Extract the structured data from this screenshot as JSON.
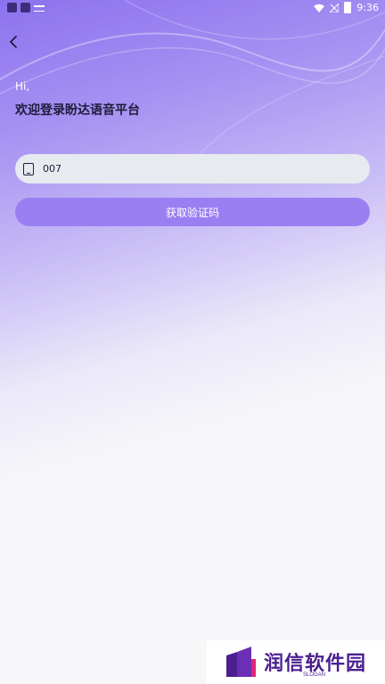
{
  "status_bar": {
    "time": "9:36"
  },
  "header": {
    "back_icon": "chevron-left-icon"
  },
  "greeting": "Hi,",
  "title": "欢迎登录盼达语音平台",
  "phone_field": {
    "value": "007",
    "icon": "phone-icon"
  },
  "get_code_button": "获取验证码",
  "watermark": {
    "text": "润信软件园",
    "slogan": "SLOGAN"
  },
  "colors": {
    "accent": "#9a7ff3",
    "gradient_top": "#8c72ee",
    "background": "#f7f7f9",
    "text": "#1e1b3a"
  }
}
